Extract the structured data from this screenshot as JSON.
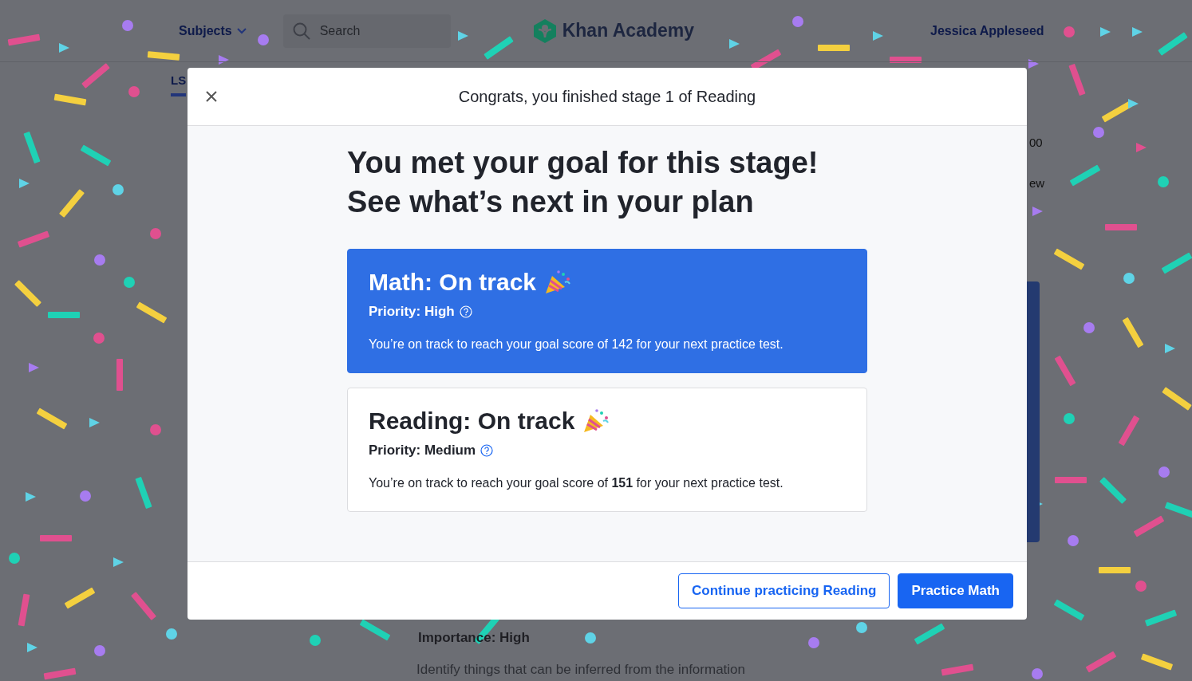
{
  "header": {
    "subjects_menu": "Subjects",
    "search": {
      "placeholder": "Search"
    },
    "logo": "Khan Academy",
    "user": "Jessica Appleseed"
  },
  "background": {
    "tab": "LS",
    "right_fragments": [
      "00",
      "ew"
    ],
    "importance": "Importance: High",
    "description": "Identify things that can be inferred from the information"
  },
  "dialog": {
    "title": "Congrats, you finished stage 1 of Reading",
    "headline": [
      "You met your goal for this stage!",
      "See what’s next in your plan"
    ],
    "cards": [
      {
        "heading": "Math: On track",
        "priority": "Priority: High",
        "text": "You’re on track to reach your goal score of 142 for your next practice test.",
        "selected": true
      },
      {
        "heading": "Reading: On track",
        "priority": "Priority: Medium",
        "text": "You’re on track to reach your goal score of **151** for your next practice test.",
        "selected": false
      }
    ],
    "buttons": [
      {
        "label": "Continue practicing Reading",
        "kind": "secondary"
      },
      {
        "label": "Practice Math",
        "kind": "primary"
      }
    ]
  }
}
